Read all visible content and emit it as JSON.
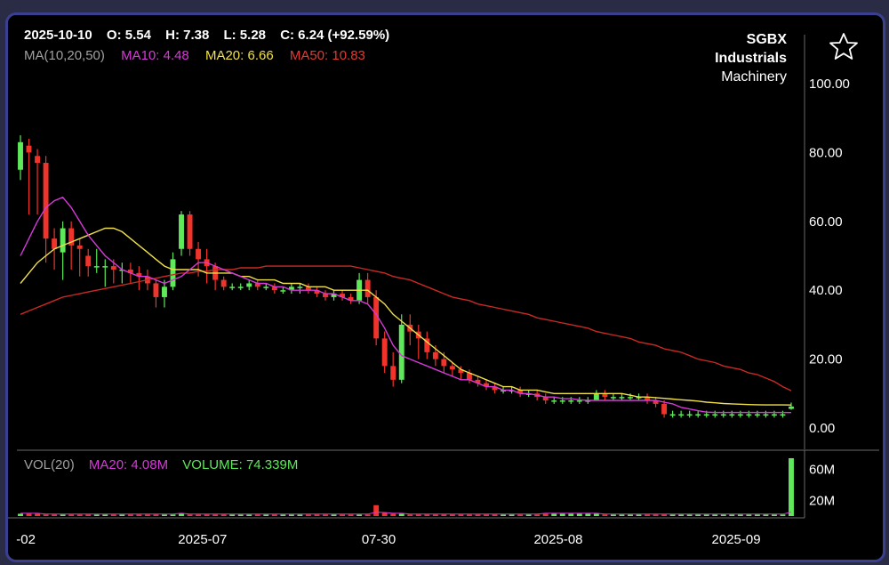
{
  "header": {
    "date": "2025-10-10",
    "open": "O: 5.54",
    "high": "H: 7.38",
    "low": "L: 5.28",
    "close": "C: 6.24 (+92.59%)",
    "ma_label": "MA(10,20,50)",
    "ma10": "MA10: 4.48",
    "ma20": "MA20: 6.66",
    "ma50": "MA50: 10.83"
  },
  "ticker": {
    "symbol": "SGBX",
    "sector": "Industrials",
    "industry": "Machinery"
  },
  "volume_header": {
    "label": "VOL(20)",
    "ma20": "MA20: 4.08M",
    "volume": "VOLUME: 74.339M"
  },
  "colors": {
    "up": "#5ee85a",
    "down": "#f0332b",
    "ma10": "#d63ad8",
    "ma20": "#f0e04a",
    "ma50": "#c92a24",
    "text": "#ffffff",
    "muted": "#a0a0a0"
  },
  "chart_data": {
    "type": "candlestick",
    "price_axis": {
      "ticks": [
        "100.00",
        "80.00",
        "60.00",
        "40.00",
        "20.00",
        "0.00"
      ],
      "values": [
        100,
        80,
        60,
        40,
        20,
        0
      ],
      "ylim": [
        0,
        100
      ]
    },
    "volume_axis": {
      "ticks": [
        "60M",
        "20M"
      ],
      "values": [
        60,
        20
      ],
      "unit": "M"
    },
    "x_labels": [
      "-02",
      "2025-07",
      "07-30",
      "2025-08",
      "2025-09"
    ],
    "candles": [
      [
        75,
        85,
        72,
        83
      ],
      [
        82,
        84,
        62,
        80
      ],
      [
        79,
        81,
        62,
        77
      ],
      [
        77,
        79,
        48,
        55
      ],
      [
        55,
        58,
        46,
        52
      ],
      [
        51,
        60,
        43,
        58
      ],
      [
        58,
        60,
        46,
        53
      ],
      [
        53,
        55,
        44,
        52
      ],
      [
        50,
        52,
        44,
        47
      ],
      [
        47,
        52,
        45,
        47
      ],
      [
        47,
        49,
        41,
        47
      ],
      [
        47,
        49,
        42,
        46
      ],
      [
        46,
        48,
        42,
        46
      ],
      [
        46,
        48,
        42,
        45
      ],
      [
        45,
        47,
        40,
        44
      ],
      [
        44,
        46,
        40,
        42
      ],
      [
        42,
        43,
        35,
        38
      ],
      [
        38,
        43,
        35,
        41
      ],
      [
        41,
        51,
        40,
        49
      ],
      [
        52,
        63,
        50,
        62
      ],
      [
        62,
        63,
        50,
        52
      ],
      [
        52,
        54,
        44,
        49
      ],
      [
        49,
        52,
        42,
        47
      ],
      [
        47,
        48,
        40,
        43
      ],
      [
        43,
        44,
        40,
        41
      ],
      [
        41,
        42,
        40,
        41
      ],
      [
        41,
        42,
        40,
        41
      ],
      [
        41,
        43,
        40,
        42
      ],
      [
        42,
        43,
        40,
        41
      ],
      [
        41,
        42,
        40,
        41
      ],
      [
        41,
        42,
        39,
        40
      ],
      [
        40,
        41,
        39,
        40
      ],
      [
        40,
        42,
        39,
        41
      ],
      [
        41,
        42,
        39,
        41
      ],
      [
        41,
        42,
        39,
        40
      ],
      [
        40,
        41,
        38,
        39
      ],
      [
        39,
        40,
        37,
        38
      ],
      [
        38,
        40,
        37,
        39
      ],
      [
        39,
        40,
        37,
        38
      ],
      [
        38,
        39,
        36,
        37
      ],
      [
        37,
        45,
        36,
        43
      ],
      [
        43,
        45,
        36,
        38
      ],
      [
        38,
        40,
        24,
        26
      ],
      [
        26,
        28,
        16,
        18
      ],
      [
        18,
        22,
        12,
        14
      ],
      [
        14,
        33,
        13,
        30
      ],
      [
        30,
        33,
        24,
        28
      ],
      [
        28,
        30,
        20,
        26
      ],
      [
        26,
        28,
        20,
        22
      ],
      [
        22,
        24,
        18,
        20
      ],
      [
        20,
        22,
        16,
        18
      ],
      [
        18,
        19,
        15,
        17
      ],
      [
        17,
        18,
        14,
        16
      ],
      [
        16,
        17,
        13,
        14
      ],
      [
        14,
        15,
        12,
        13
      ],
      [
        13,
        14,
        11,
        12
      ],
      [
        12,
        13,
        10,
        11
      ],
      [
        11,
        12,
        10,
        11
      ],
      [
        11,
        12,
        10,
        11
      ],
      [
        11,
        12,
        9,
        10
      ],
      [
        10,
        11,
        9,
        10
      ],
      [
        10,
        11,
        8,
        9
      ],
      [
        9,
        10,
        7,
        8
      ],
      [
        8,
        9,
        7,
        8
      ],
      [
        8,
        9,
        7,
        8
      ],
      [
        8,
        9,
        7,
        8
      ],
      [
        8,
        9,
        7,
        8
      ],
      [
        8,
        9,
        7,
        8
      ],
      [
        8,
        11,
        8,
        10
      ],
      [
        10,
        11,
        8,
        9
      ],
      [
        9,
        10,
        8,
        9
      ],
      [
        9,
        10,
        8,
        9
      ],
      [
        9,
        10,
        8,
        9
      ],
      [
        9,
        10,
        8,
        9
      ],
      [
        9,
        10,
        7,
        8
      ],
      [
        8,
        9,
        6,
        7
      ],
      [
        7,
        8,
        3,
        4
      ],
      [
        4,
        5,
        3,
        4
      ],
      [
        4,
        5,
        3,
        4
      ],
      [
        4,
        5,
        3,
        4
      ],
      [
        4,
        5,
        3,
        4
      ],
      [
        4,
        5,
        3,
        4
      ],
      [
        4,
        5,
        3,
        4
      ],
      [
        4,
        5,
        3,
        4
      ],
      [
        4,
        5,
        3,
        4
      ],
      [
        4,
        5,
        3,
        4
      ],
      [
        4,
        5,
        3,
        4
      ],
      [
        4,
        5,
        3,
        4
      ],
      [
        4,
        5,
        3,
        4
      ],
      [
        4,
        5,
        3,
        4
      ],
      [
        4,
        5,
        3,
        4
      ],
      [
        5.54,
        7.38,
        5.28,
        6.24
      ]
    ],
    "volumes": [
      3,
      3,
      3,
      2,
      2,
      2,
      2,
      2,
      2,
      2,
      2,
      2,
      2,
      2,
      2,
      2,
      2,
      2,
      2,
      3,
      2,
      2,
      2,
      2,
      2,
      2,
      2,
      2,
      2,
      2,
      2,
      2,
      2,
      2,
      2,
      2,
      2,
      2,
      2,
      2,
      2,
      2,
      14,
      4,
      3,
      3,
      2,
      2,
      2,
      2,
      2,
      2,
      2,
      2,
      2,
      2,
      2,
      2,
      2,
      2,
      2,
      2,
      3,
      3,
      3,
      3,
      3,
      3,
      3,
      2,
      2,
      2,
      2,
      2,
      2,
      2,
      2,
      2,
      2,
      2,
      2,
      2,
      2,
      2,
      2,
      2,
      2,
      2,
      2,
      2,
      2,
      74.339
    ],
    "ma10": [
      50,
      55,
      60,
      64,
      66,
      67,
      64,
      60,
      56,
      53,
      50,
      48,
      46,
      45,
      44,
      44,
      43,
      42,
      43,
      44,
      46,
      48,
      48,
      47,
      46,
      45,
      44,
      43,
      42,
      42,
      41,
      41,
      40,
      40,
      40,
      40,
      39,
      39,
      38,
      37,
      37,
      36,
      33,
      29,
      24,
      21,
      20,
      19,
      18,
      17,
      16,
      15,
      14,
      14,
      13,
      12,
      12,
      11,
      11,
      10,
      10,
      9.5,
      9,
      9,
      8.5,
      8.5,
      8.2,
      8,
      8,
      8,
      8,
      8,
      8,
      8,
      8,
      8,
      7.5,
      7,
      6,
      5.5,
      5,
      4.6,
      4.5,
      4.5,
      4.5,
      4.5,
      4.5,
      4.5,
      4.5,
      4.5,
      4.5,
      4.48
    ],
    "ma20": [
      42,
      45,
      48,
      50,
      52,
      53,
      54,
      55,
      56,
      57,
      58,
      58,
      57,
      55,
      53,
      51,
      49,
      47,
      46,
      46,
      46,
      46,
      45,
      45,
      45,
      45,
      44,
      44,
      43,
      43,
      43,
      42,
      42,
      42,
      41,
      41,
      41,
      40,
      40,
      40,
      40,
      40,
      38,
      36,
      33,
      31,
      29,
      27,
      25,
      23,
      21,
      19,
      17,
      16,
      15,
      14,
      13,
      12,
      12,
      11,
      11,
      11,
      10.5,
      10,
      10,
      10,
      10,
      10,
      10,
      10,
      10,
      10,
      9.5,
      9,
      9,
      8.8,
      8.6,
      8.4,
      8.2,
      8,
      7.8,
      7.5,
      7.3,
      7.1,
      7,
      6.9,
      6.8,
      6.75,
      6.7,
      6.7,
      6.68,
      6.66
    ],
    "ma50": [
      33,
      34,
      35,
      36,
      37,
      38,
      38.5,
      39,
      39.5,
      40,
      40.5,
      41,
      41.5,
      42,
      42.5,
      43,
      43.5,
      44,
      44.5,
      45,
      45,
      45.5,
      45.5,
      46,
      46,
      46,
      46.5,
      46.5,
      46.5,
      47,
      47,
      47,
      47,
      47,
      47,
      47,
      47,
      47,
      47,
      47,
      46.5,
      46,
      45.5,
      45,
      44,
      43.5,
      43,
      42,
      41,
      40,
      39,
      38,
      37.5,
      37,
      36,
      35.5,
      35,
      34.5,
      34,
      33.5,
      33,
      32,
      31.5,
      31,
      30.5,
      30,
      29.5,
      29,
      28,
      27.5,
      27,
      26.5,
      26,
      25,
      24.5,
      24,
      23,
      22.5,
      22,
      21,
      20,
      19.5,
      19,
      18,
      17.5,
      17,
      16,
      15.5,
      14.5,
      13.5,
      12,
      10.83
    ]
  }
}
